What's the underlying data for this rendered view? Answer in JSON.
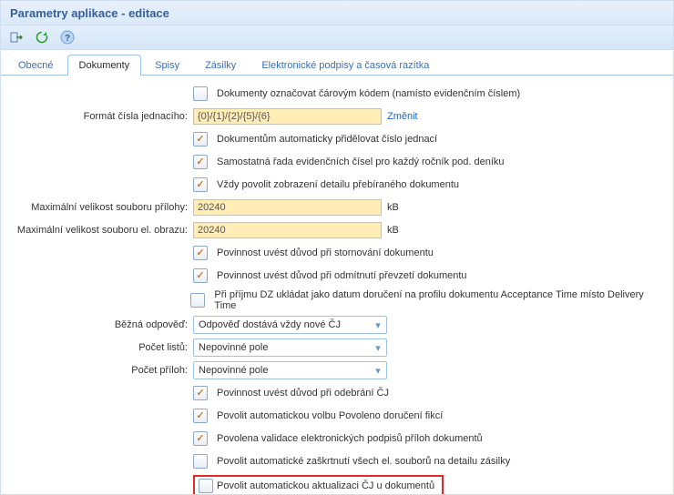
{
  "header": {
    "title": "Parametry aplikace - editace"
  },
  "tabs": [
    "Obecné",
    "Dokumenty",
    "Spisy",
    "Zásilky",
    "Elektronické podpisy a časová razítka"
  ],
  "form": {
    "r1": {
      "checked": false,
      "label": "Dokumenty označovat čárovým kódem (namísto evidenčním číslem)"
    },
    "r2": {
      "label": "Formát čísla jednacího:",
      "value": "{0}/{1}/{2}/{5}/{6}",
      "action": "Změnit"
    },
    "r3": {
      "checked": true,
      "label": "Dokumentům automaticky přidělovat číslo jednací"
    },
    "r4": {
      "checked": true,
      "label": "Samostatná řada evidenčních čísel pro každý ročník pod. deníku"
    },
    "r5": {
      "checked": true,
      "label": "Vždy povolit zobrazení detailu přebíraného dokumentu"
    },
    "r6": {
      "label": "Maximální velikost souboru přílohy:",
      "value": "20240",
      "unit": "kB"
    },
    "r7": {
      "label": "Maximální velikost souboru el. obrazu:",
      "value": "20240",
      "unit": "kB"
    },
    "r8": {
      "checked": true,
      "label": "Povinnost uvést důvod při stornování dokumentu"
    },
    "r9": {
      "checked": true,
      "label": "Povinnost uvést důvod při odmítnutí převzetí dokumentu"
    },
    "r10": {
      "checked": false,
      "label": "Při příjmu DZ ukládat jako datum doručení na profilu dokumentu Acceptance Time místo Delivery Time"
    },
    "r11": {
      "label": "Běžná odpověď:",
      "value": "Odpověď dostává vždy nové ČJ"
    },
    "r12": {
      "label": "Počet listů:",
      "value": "Nepovinné pole"
    },
    "r13": {
      "label": "Počet příloh:",
      "value": "Nepovinné pole"
    },
    "r14": {
      "checked": true,
      "label": "Povinnost uvést důvod při odebrání ČJ"
    },
    "r15": {
      "checked": true,
      "label": "Povolit automatickou volbu Povoleno doručení fikcí"
    },
    "r16": {
      "checked": true,
      "label": "Povolena validace elektronických podpisů příloh dokumentů"
    },
    "r17": {
      "checked": false,
      "label": "Povolit automatické zaškrtnutí všech el. souborů na detailu zásilky"
    },
    "r18": {
      "checked": false,
      "label": "Povolit automatickou aktualizaci ČJ u dokumentů"
    }
  }
}
